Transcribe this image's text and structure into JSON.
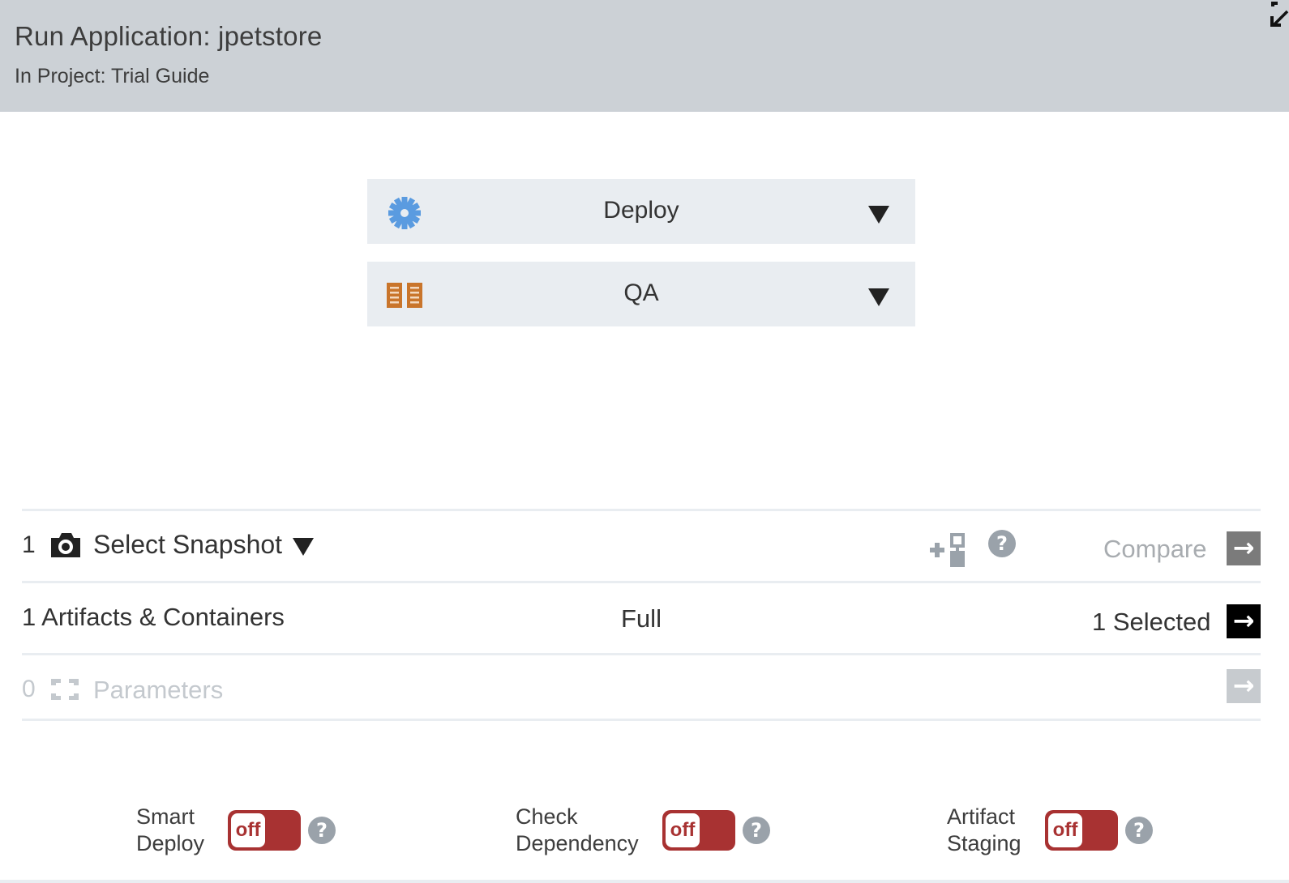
{
  "header": {
    "title": "Run Application: jpetstore",
    "subtitle": "In Project: Trial Guide",
    "expand_icon": "expand-collapse-arrow-icon"
  },
  "selectors": {
    "process": {
      "label": "Deploy",
      "icon": "gear-icon",
      "icon_color": "#5a9be0"
    },
    "environment": {
      "label": "QA",
      "icon": "environment-servers-icon",
      "icon_color": "#c9752b"
    }
  },
  "snapshot_row": {
    "count": "1",
    "label": "Select Snapshot",
    "compare_label": "Compare",
    "help": "?"
  },
  "artifacts_row": {
    "label": "1 Artifacts & Containers",
    "mode": "Full",
    "selected": "1 Selected"
  },
  "parameters_row": {
    "count": "0",
    "label": "Parameters"
  },
  "toggles": [
    {
      "label_line1": "Smart",
      "label_line2": "Deploy",
      "state": "off",
      "help": "?"
    },
    {
      "label_line1": "Check",
      "label_line2": "Dependency",
      "state": "off",
      "help": "?"
    },
    {
      "label_line1": "Artifact",
      "label_line2": "Staging",
      "state": "off",
      "help": "?"
    }
  ],
  "colors": {
    "header_bg": "#ccd1d6",
    "selector_bg": "#e9edf1",
    "toggle_off": "#a83232",
    "help_icon": "#9aa2aa"
  },
  "arrow_glyph": "→"
}
